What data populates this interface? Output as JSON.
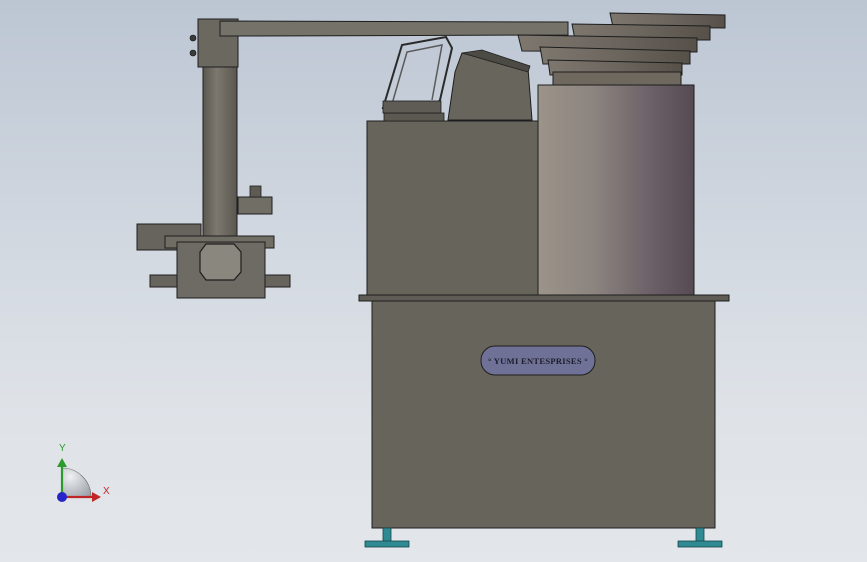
{
  "viewport": {
    "background_top": "#bcc6d3",
    "background_bottom": "#e3e6ea"
  },
  "model": {
    "nameplate": {
      "text": "° YUMI ENTESPRISES °",
      "fill": "#6f7196",
      "text_color": "#1c1c2a"
    },
    "colors": {
      "body": "#6a675f",
      "body_dark": "#575449",
      "outline": "#1e1e1e",
      "hopper_light": "#a49a8e",
      "hopper_dark": "#5b5158",
      "feet": "#2f8a93"
    }
  },
  "triad": {
    "x_label": "X",
    "y_label": "Y",
    "x_color": "#c02626",
    "y_color": "#2c9a2c",
    "z_color": "#2424c8"
  }
}
